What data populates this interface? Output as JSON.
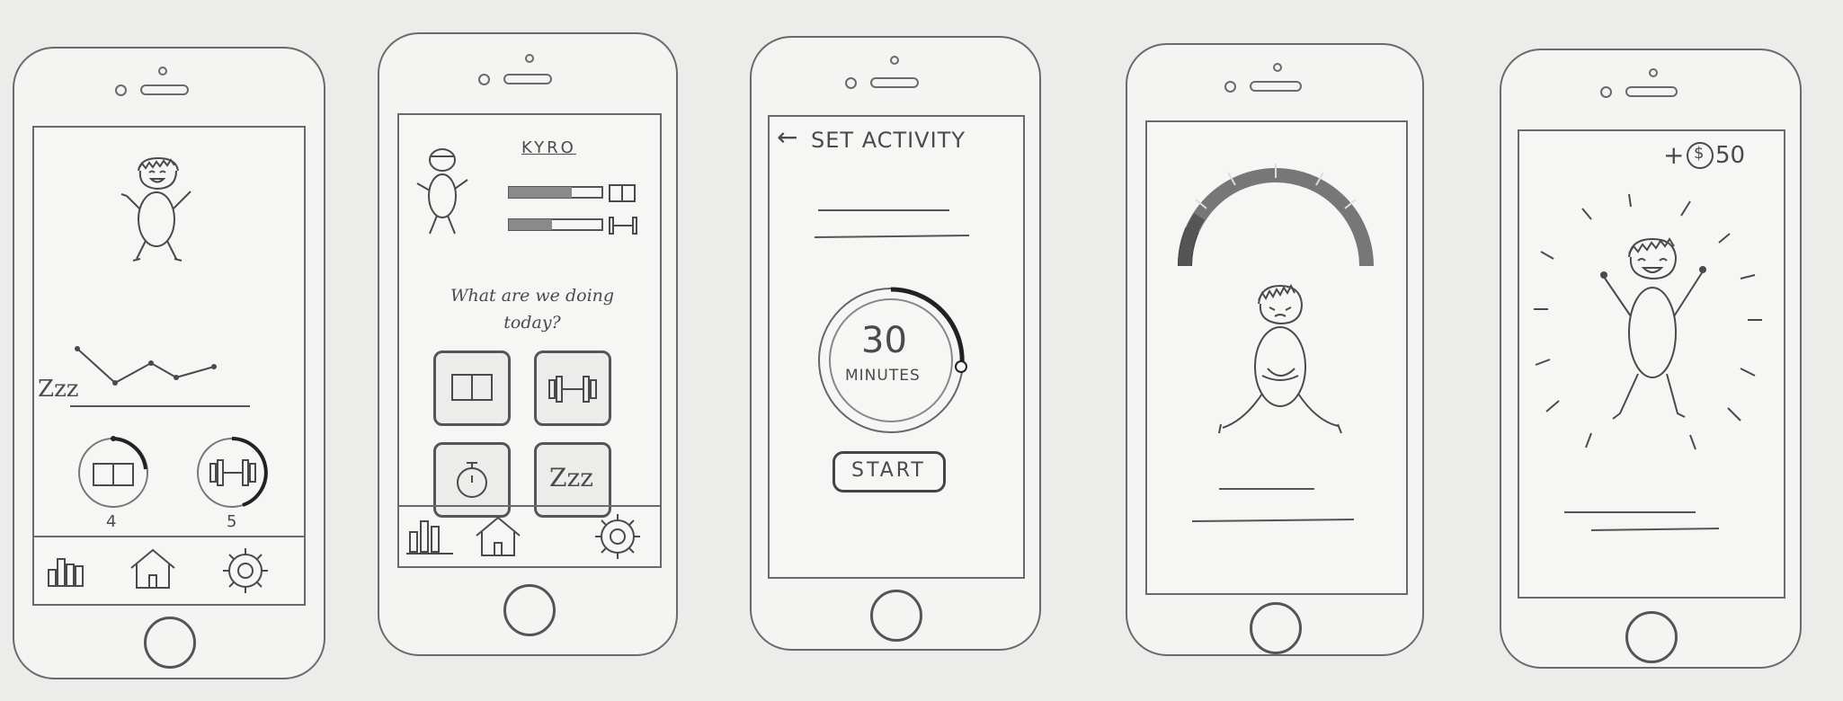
{
  "screen1": {
    "sleep_label": "Zzz",
    "book_count": "4",
    "gym_count": "5",
    "nav": {
      "stats_icon": "bar-chart-icon",
      "home_icon": "home-icon",
      "settings_icon": "gear-icon"
    }
  },
  "screen2": {
    "character_name": "KYRO",
    "prompt": "What are we doing today?",
    "activities": [
      "book-icon",
      "dumbbell-icon",
      "timer-icon",
      "sleep-icon"
    ],
    "sleep_label": "Zzz"
  },
  "screen3": {
    "back_arrow": "←",
    "title": "SET ACTIVITY",
    "timer_value": "30",
    "timer_unit": "MINUTES",
    "start_label": "START"
  },
  "screen4": {
    "progress_fraction": 0.2
  },
  "screen5": {
    "reward": "+$50",
    "reward_plus": "+",
    "reward_currency": "$",
    "reward_amount": "50"
  },
  "colors": {
    "pencil": "#4a4a4a",
    "paper": "#ececea"
  }
}
